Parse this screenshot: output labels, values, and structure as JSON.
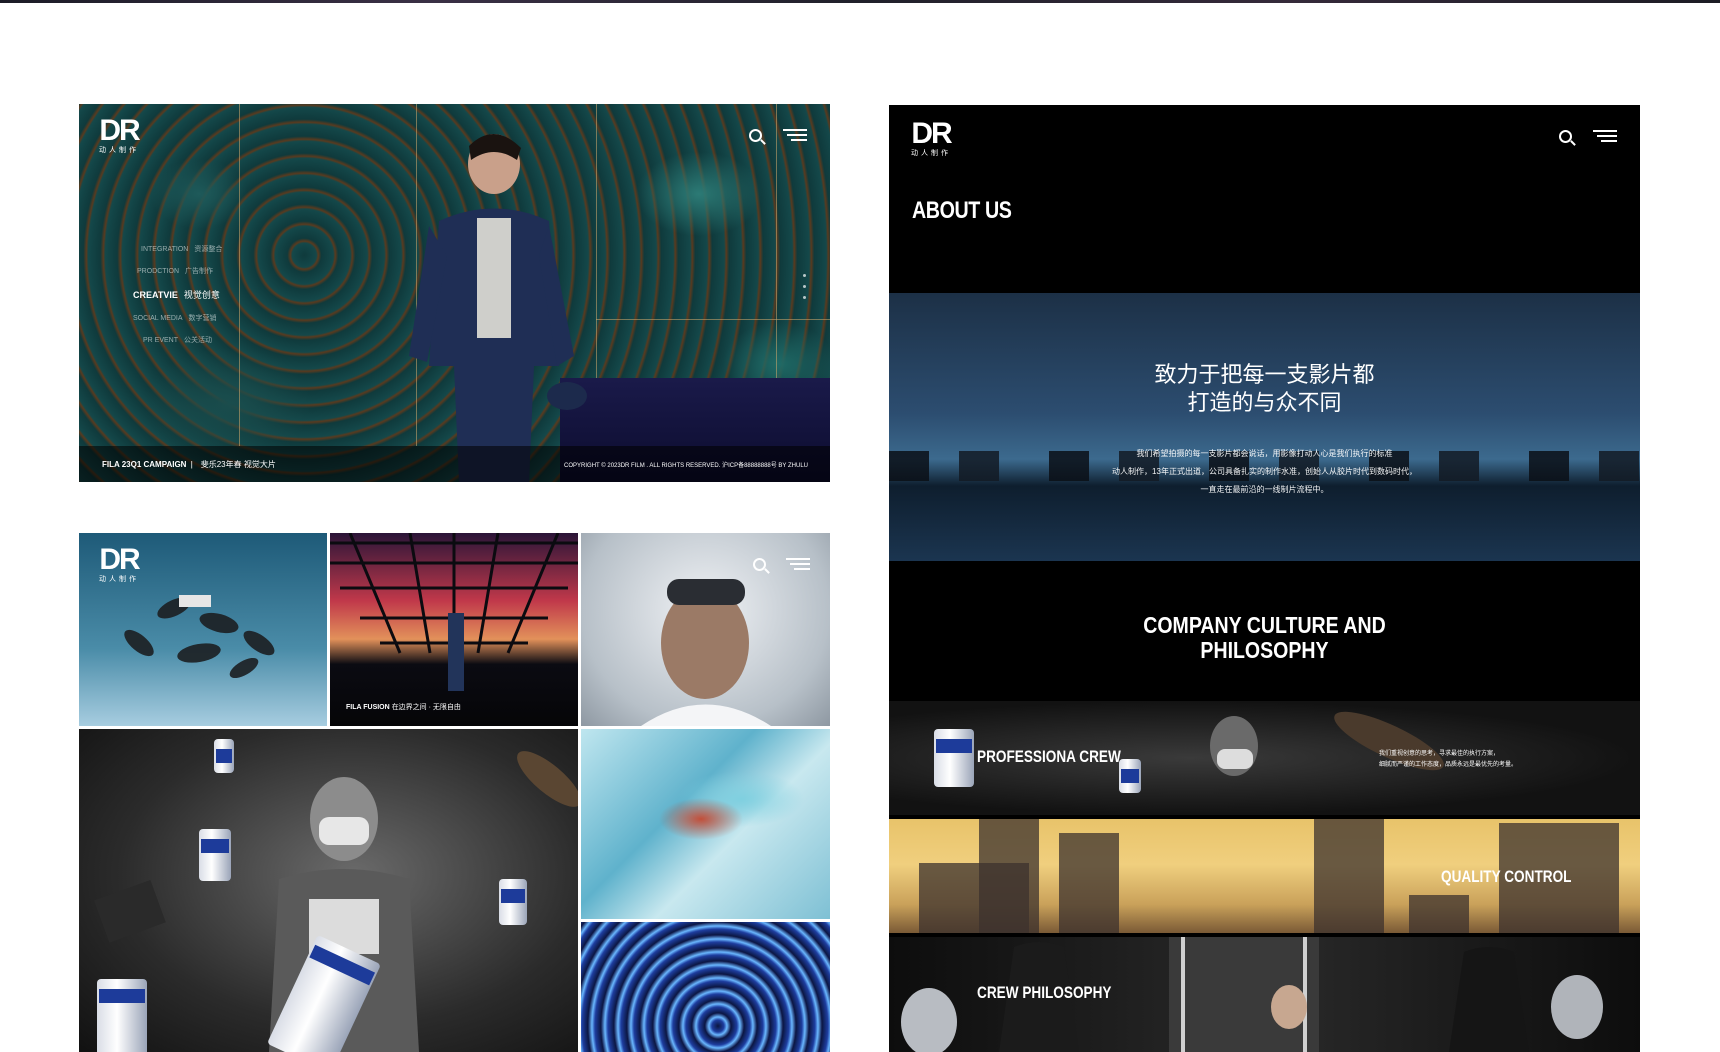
{
  "brand": {
    "logo_text": "DR",
    "logo_sub": "动人制作"
  },
  "fila_panel": {
    "menu": [
      {
        "en": "INTEGRATION",
        "cn": "资源整合",
        "active": false
      },
      {
        "en": "PRODCTION",
        "cn": "广告制作",
        "active": false
      },
      {
        "en": "CREATVIE",
        "cn": "视觉创意",
        "active": true
      },
      {
        "en": "SOCIAL MEDIA",
        "cn": "数字营销",
        "active": false
      },
      {
        "en": "PR EVENT",
        "cn": "公关活动",
        "active": false
      }
    ],
    "caption_en": "FILA 23Q1 CAMPAIGN",
    "caption_cn": "斐乐23年春 视觉大片",
    "copyright": "COPYRIGHT © 2023DR FILM . ALL RIGHTS RESERVED. 沪ICP备88888888号 BY ZHULU"
  },
  "collage_panel": {
    "tile2_caption_en": "FILA FUSION",
    "tile2_caption_cn": "在边界之间 · 无限自由"
  },
  "about_panel": {
    "title": "ABOUT US",
    "hero_line1": "致力于把每一支影片都",
    "hero_line2": "打造的与众不同",
    "desc_line1": "我们希望拍摄的每一支影片都会说话，用影像打动人心是我们执行的标准",
    "desc_line2": "动人制作，13年正式出道，公司具备扎实的制作水准，创始人从胶片时代到数码时代，",
    "desc_line3": "一直走在最前沿的一线制片流程中。",
    "culture_line1": "COMPANY CULTURE AND",
    "culture_line2": "PHILOSOPHY",
    "strips": [
      {
        "label": "PROFESSIONA CREW",
        "desc1": "我们重视创意的思考，寻求最佳的执行方案，",
        "desc2": "细腻而严谨的工作态度，品质永远是最优先的考量。"
      },
      {
        "label": "QUALITY CONTROL"
      },
      {
        "label": "CREW PHILOSOPHY"
      }
    ]
  }
}
